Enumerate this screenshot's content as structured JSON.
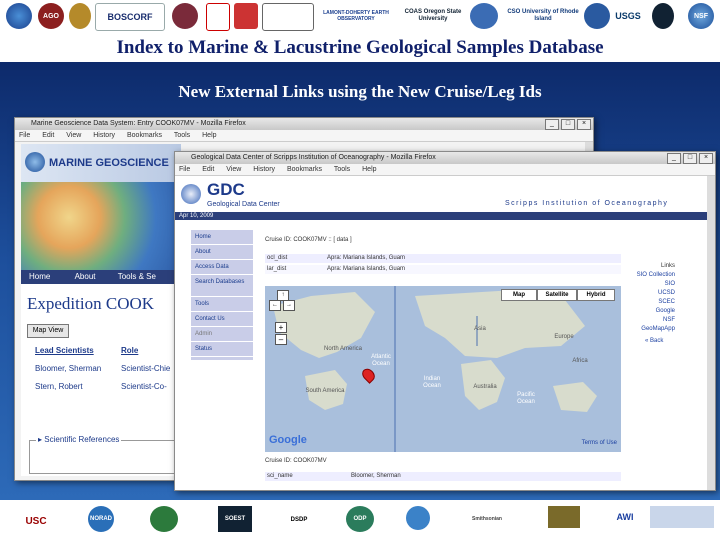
{
  "header": {
    "title": "Index to Marine & Lacustrine Geological Samples Database",
    "subtitle": "New External Links using the New Cruise/Leg Ids",
    "logos": [
      "AGO",
      "BOSCORF",
      "LAMONT-DOHERTY EARTH OBSERVATORY",
      "COAS Oregon State University",
      "CSO University of Rhode Island",
      "USGS",
      "NSF"
    ]
  },
  "window_back": {
    "title": "Marine Geoscience Data System: Entry COOK07MV - Mozilla Firefox",
    "menu": [
      "File",
      "Edit",
      "View",
      "History",
      "Bookmarks",
      "Tools",
      "Help"
    ],
    "banner": "MARINE GEOSCIENCE",
    "nav": [
      "Home",
      "About",
      "Tools & Se"
    ],
    "expedition": "Expedition COOK",
    "map_view_button": "Map View",
    "table_headers": [
      "Lead Scientists",
      "Role"
    ],
    "rows": [
      {
        "name": "Bloomer, Sherman",
        "role": "Scientist-Chie"
      },
      {
        "name": "Stern, Robert",
        "role": "Scientist-Co-"
      }
    ],
    "references_label": "Scientific References"
  },
  "window_front": {
    "title": "Geological Data Center of Scripps Institution of Oceanography - Mozilla Firefox",
    "menu": [
      "File",
      "Edit",
      "View",
      "History",
      "Bookmarks",
      "Tools",
      "Help"
    ],
    "gdc_logo": "GDC",
    "gdc_name": "Geological Data Center",
    "scripps": "Scripps Institution of Oceanography",
    "date": "Apr 10, 2009",
    "nav": [
      "Home",
      "About",
      "Access Data",
      "Search Databases",
      "Tools",
      "Contact Us",
      "Admin",
      "Status"
    ],
    "cruise_line": "Cruise ID: COOK07MV :: [ data ]",
    "table_rows": [
      {
        "k": "ocl_dist",
        "v": "Apra: Mariana Islands, Guam"
      },
      {
        "k": "lar_dist",
        "v": "Apra: Mariana Islands, Guam"
      }
    ],
    "map_buttons": [
      "Map",
      "Satellite",
      "Hybrid"
    ],
    "zoom_controls": [
      "+",
      "–"
    ],
    "continents": [
      "North America",
      "Europe",
      "Asia",
      "Africa",
      "Australia",
      "South America",
      "Atlantic Ocean",
      "Indian Ocean",
      "Pacific Ocean"
    ],
    "powered_by": "Google",
    "terms": "Terms of Use",
    "cruise_line2": "Cruise ID: COOK07MV",
    "bottom_row": {
      "k": "sci_name",
      "v": "Bloomer, Sherman"
    },
    "right_links": [
      "Links",
      "SIO Collection",
      "SIO",
      "UCSD",
      "SCEC",
      "Google",
      "NSF",
      "GeoMapApp"
    ],
    "back_link": "« Back"
  },
  "footer": {
    "logos": [
      "USC",
      "NORAD",
      "SOEST",
      "DSDP",
      "ODP",
      "Smithsonian",
      "AWI"
    ]
  },
  "colors": {
    "title": "#10206a",
    "background": "#1d4f9c",
    "nav": "#c9cde8",
    "ocean": "#a9bfdc",
    "land": "#d8dccd"
  }
}
